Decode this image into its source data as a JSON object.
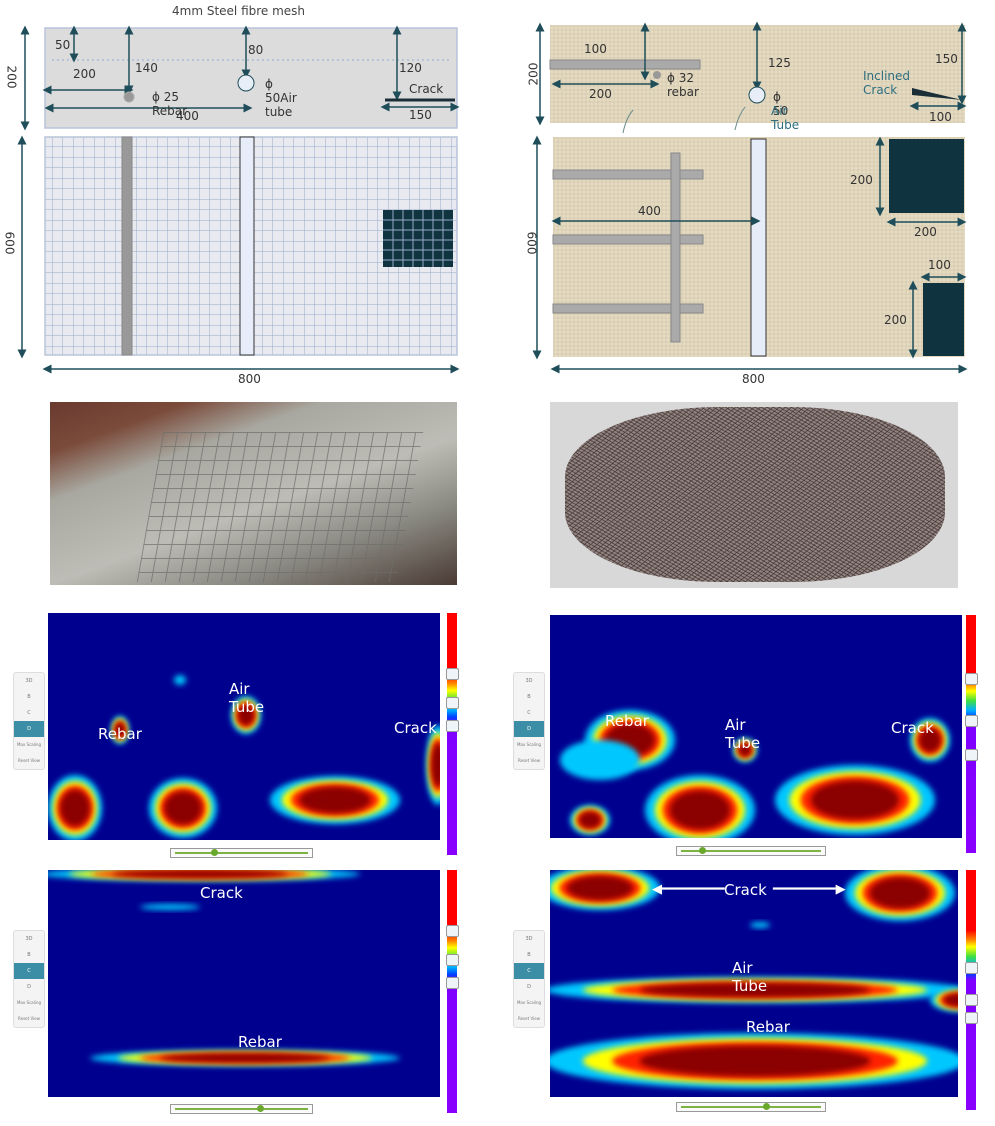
{
  "left_design": {
    "title": "4mm Steel fibre mesh",
    "dims": {
      "d50": "50",
      "d80": "80",
      "d140": "140",
      "d120": "120",
      "d200": "200",
      "d400": "400",
      "d150": "150",
      "height": "200",
      "plan_height": "600",
      "width": "800"
    },
    "rebar": "ϕ 25 Rebar",
    "air_tube": "ϕ 50Air tube",
    "crack": "Crack"
  },
  "right_design": {
    "dims": {
      "d100": "100",
      "d200": "200",
      "d125": "125",
      "d150": "150",
      "d100b": "100",
      "height": "200",
      "plan_height": "600",
      "d400": "400",
      "sq200a": "200",
      "sq200b": "200",
      "sq100": "100",
      "sq200c": "200",
      "width": "800"
    },
    "rebar": "ϕ 32 rebar",
    "air_tube_dia": "ϕ 50",
    "air_tube": "Air Tube",
    "crack": "Inclined Crack"
  },
  "heatmaps": {
    "tl": {
      "labels": [
        "Air Tube",
        "Rebar",
        "Crack"
      ]
    },
    "tr": {
      "labels": [
        "Rebar",
        "Air Tube",
        "Crack"
      ]
    },
    "bl": {
      "labels": [
        "Crack",
        "Rebar"
      ]
    },
    "br": {
      "labels": [
        "Crack",
        "Air Tube",
        "Rebar"
      ]
    }
  },
  "viewer_panel": {
    "buttons": [
      "3D",
      "B",
      "C",
      "D"
    ],
    "max_scaling": "Max Scaling",
    "reset_view": "Reset View"
  },
  "colors": {
    "heat_bg": "#00008f",
    "accent": "#3b8ea5",
    "dim_line": "#1f4e5a"
  }
}
